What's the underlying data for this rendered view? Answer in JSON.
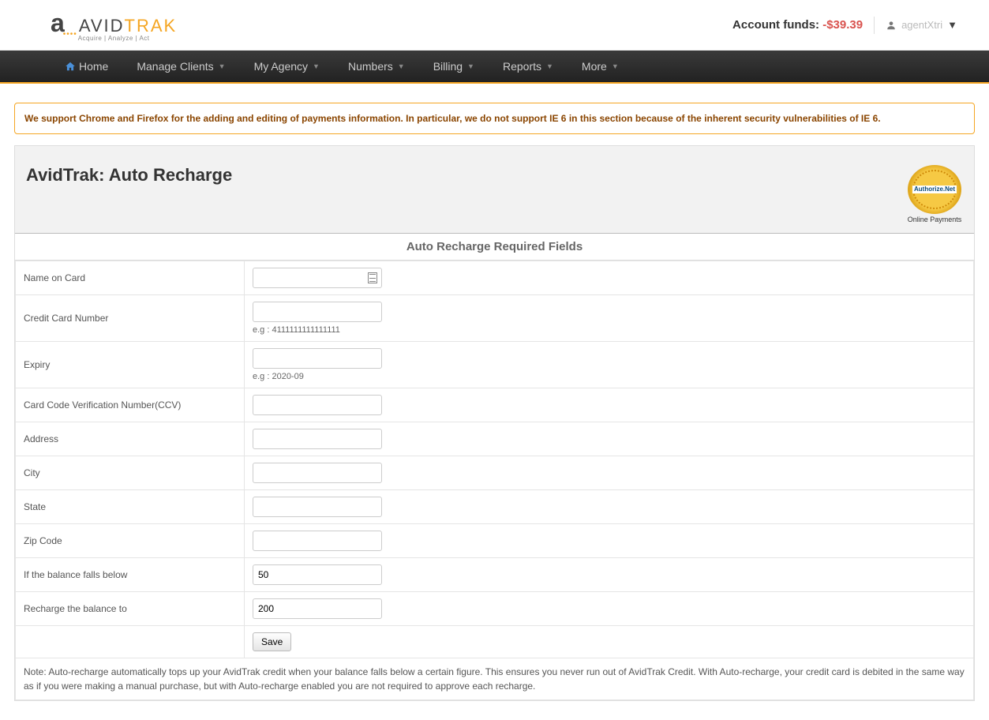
{
  "header": {
    "logo_main": "AVID",
    "logo_accent": "TRAK",
    "logo_sub": "Acquire | Analyze | Act",
    "funds_label": "Account funds: ",
    "funds_amount": "-$39.39",
    "user_name": "agentXtri"
  },
  "nav": {
    "home": "Home",
    "manage_clients": "Manage Clients",
    "my_agency": "My Agency",
    "numbers": "Numbers",
    "billing": "Billing",
    "reports": "Reports",
    "more": "More"
  },
  "alert": "We support Chrome and Firefox for the adding and editing of payments information. In particular, we do not support IE 6 in this section because of the inherent security vulnerabilities of IE 6.",
  "panel": {
    "title": "AvidTrak: Auto Recharge",
    "badge_text": "Authorize.Net",
    "badge_sub": "Online Payments",
    "section_title": "Auto Recharge Required Fields"
  },
  "fields": {
    "name_label": "Name on Card",
    "cc_label": "Credit Card Number",
    "cc_hint": "e.g : 4111111111111111",
    "expiry_label": "Expiry",
    "expiry_hint": "e.g : 2020-09",
    "ccv_label": "Card Code Verification Number(CCV)",
    "address_label": "Address",
    "city_label": "City",
    "state_label": "State",
    "zip_label": "Zip Code",
    "threshold_label": "If the balance falls below",
    "threshold_value": "50",
    "recharge_label": "Recharge the balance to",
    "recharge_value": "200",
    "save_label": "Save"
  },
  "note": "Note: Auto-recharge automatically tops up your AvidTrak credit when your balance falls below a certain figure. This ensures you never run out of AvidTrak Credit. With Auto-recharge, your credit card is debited in the same way as if you were making a manual purchase, but with Auto-recharge enabled you are not required to approve each recharge."
}
